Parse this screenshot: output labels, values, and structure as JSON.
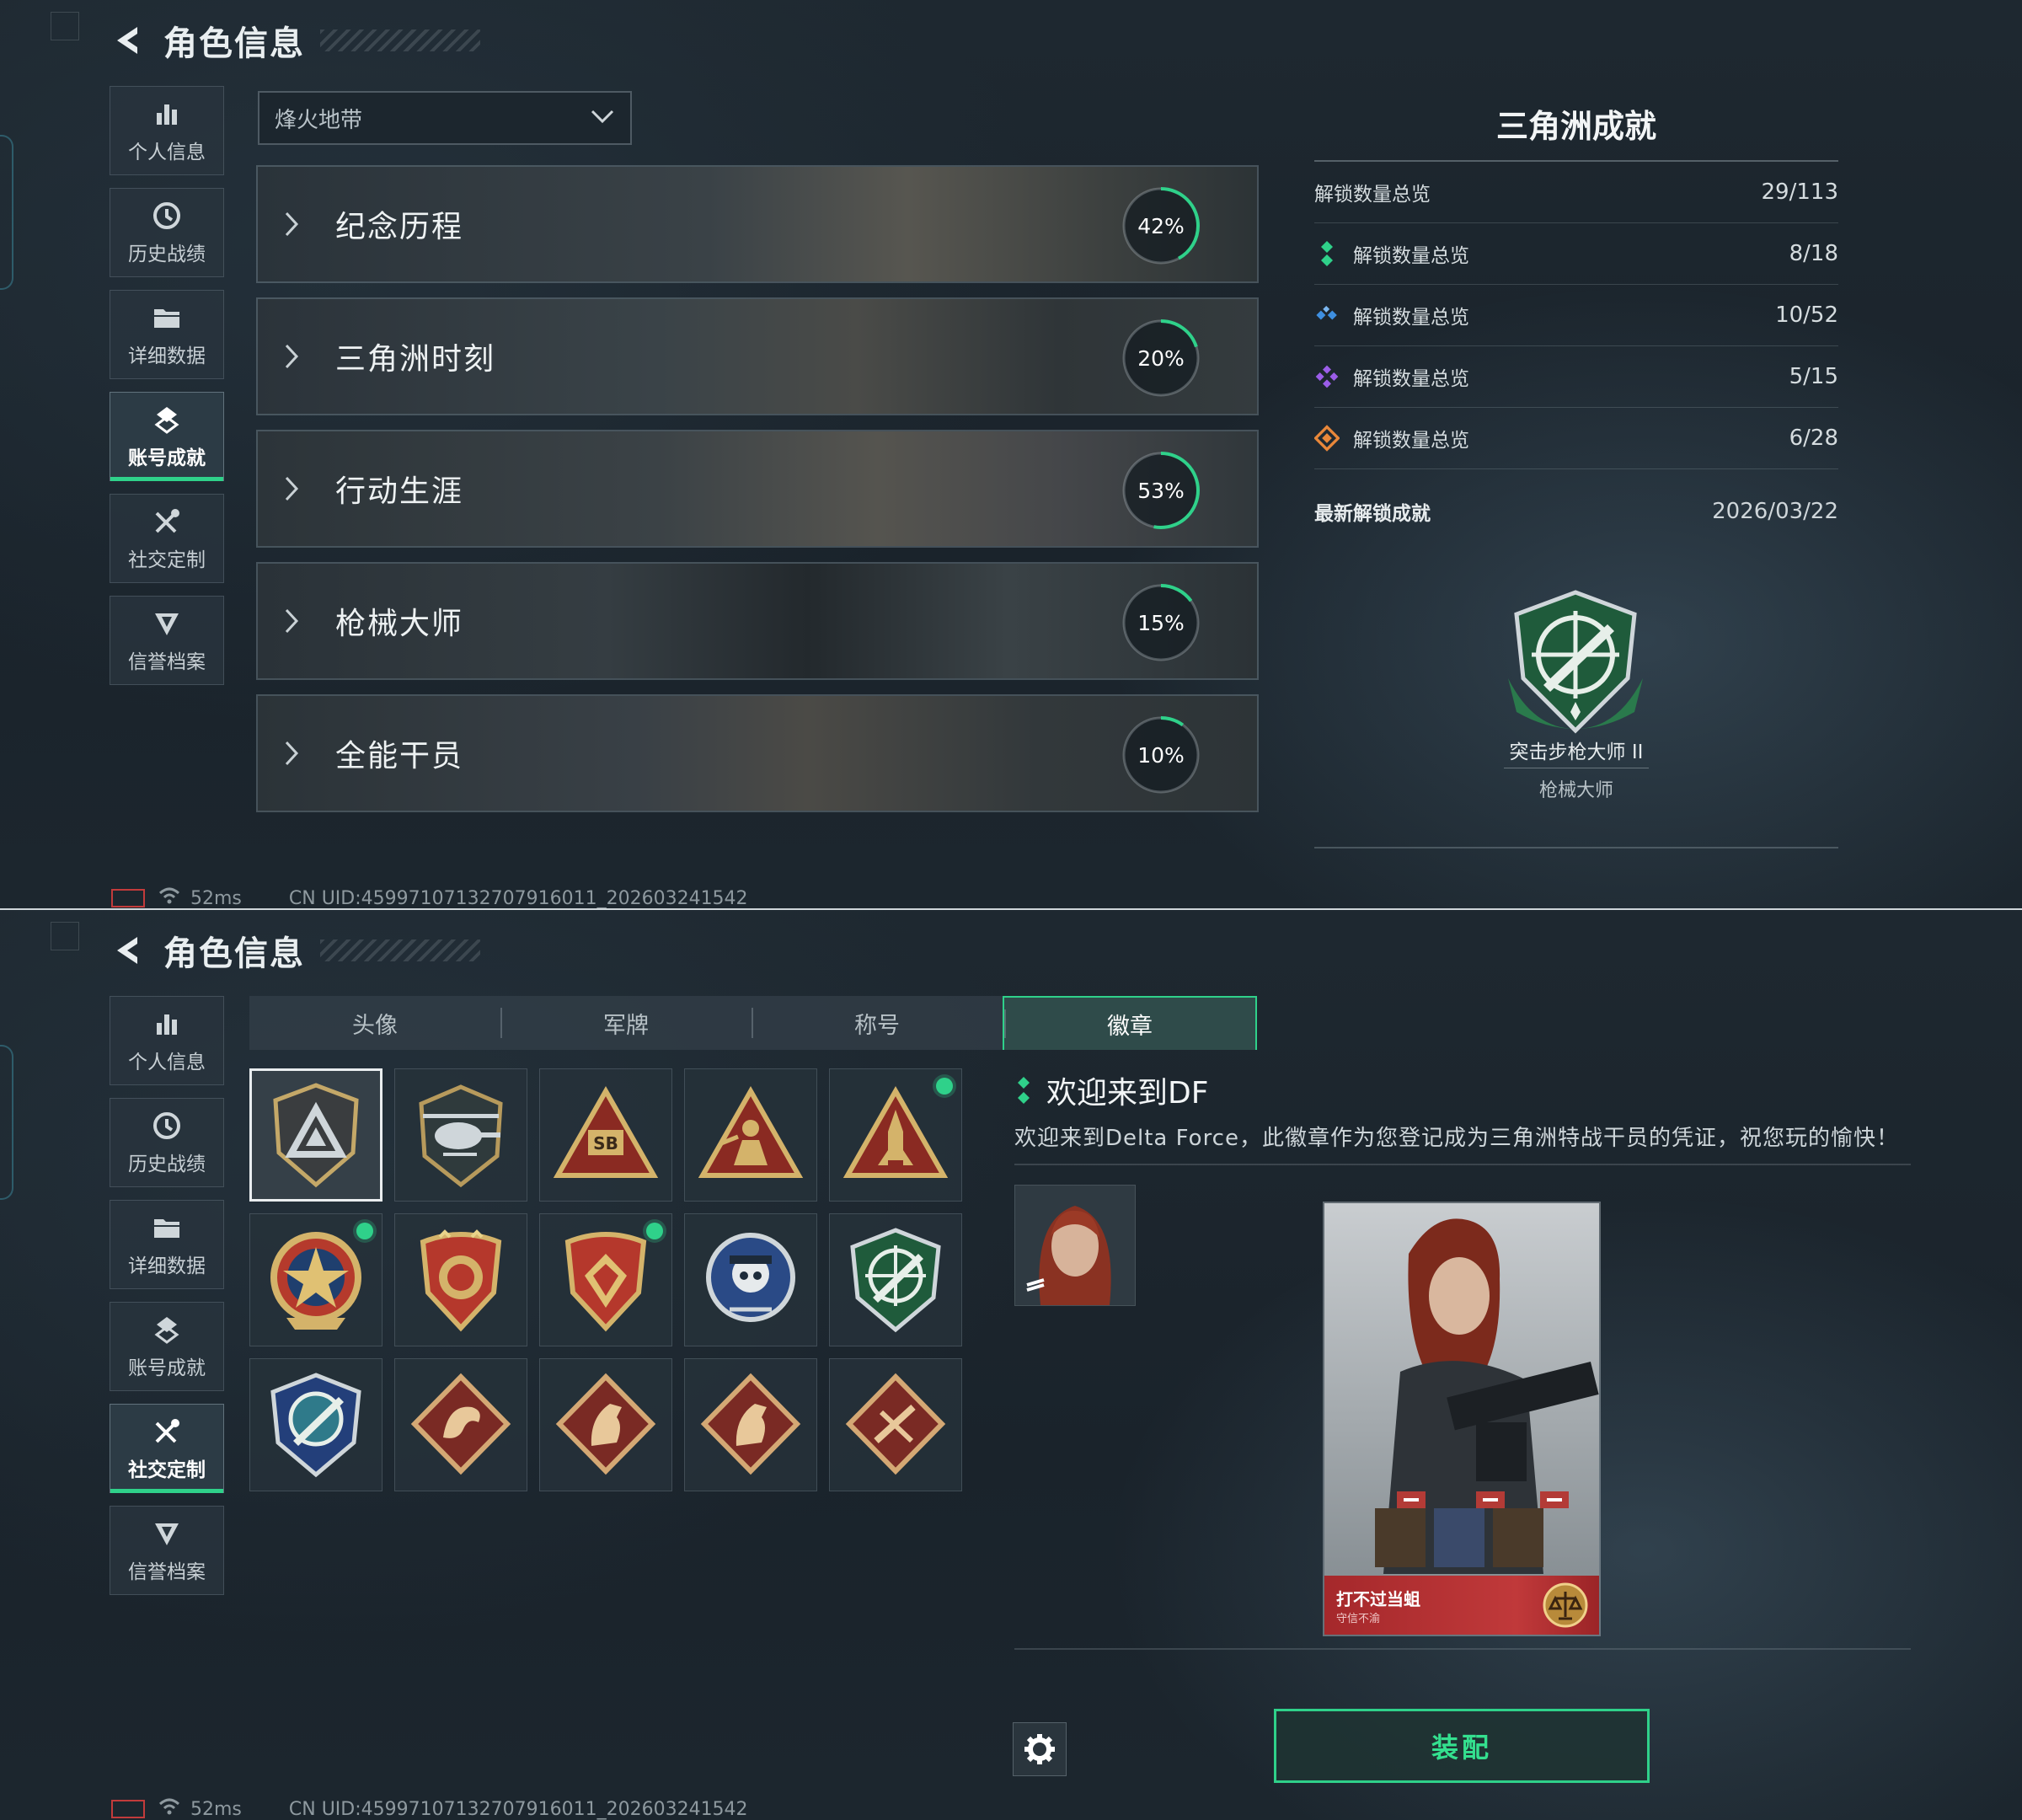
{
  "header": {
    "title": "角色信息"
  },
  "nav": [
    {
      "label": "个人信息"
    },
    {
      "label": "历史战绩"
    },
    {
      "label": "详细数据"
    },
    {
      "label": "账号成就"
    },
    {
      "label": "社交定制"
    },
    {
      "label": "信誉档案"
    }
  ],
  "top": {
    "mode_select": "烽火地带",
    "categories": [
      {
        "label": "纪念历程",
        "percent": "42%",
        "progress": 0.42
      },
      {
        "label": "三角洲时刻",
        "percent": "20%",
        "progress": 0.2
      },
      {
        "label": "行动生涯",
        "percent": "53%",
        "progress": 0.53
      },
      {
        "label": "枪械大师",
        "percent": "15%",
        "progress": 0.15
      },
      {
        "label": "全能干员",
        "percent": "10%",
        "progress": 0.1
      }
    ],
    "stats": {
      "title": "三角洲成就",
      "rows": [
        {
          "label": "解锁数量总览",
          "value": "29/113",
          "icon": "none"
        },
        {
          "label": "解锁数量总览",
          "value": "8/18",
          "icon": "green-diamond-icon",
          "color": "#2fd18a"
        },
        {
          "label": "解锁数量总览",
          "value": "10/52",
          "icon": "blue-diamond-icon",
          "color": "#3e8fe0"
        },
        {
          "label": "解锁数量总览",
          "value": "5/15",
          "icon": "purple-diamond-icon",
          "color": "#9b5de8"
        },
        {
          "label": "解锁数量总览",
          "value": "6/28",
          "icon": "orange-diamond-icon",
          "color": "#e8873a"
        }
      ],
      "latest_label": "最新解锁成就",
      "latest_date": "2026/03/22",
      "latest_badge_name": "突击步枪大师 II",
      "latest_badge_category": "枪械大师"
    }
  },
  "status": {
    "ping": "52ms",
    "uid": "CN UID:45997107132707916011_202603241542"
  },
  "bottom": {
    "tabs": [
      {
        "label": "头像"
      },
      {
        "label": "军牌"
      },
      {
        "label": "称号"
      },
      {
        "label": "徽章"
      }
    ],
    "active_tab": "徽章",
    "detail": {
      "title": "欢迎来到DF",
      "desc": "欢迎来到Delta Force，此徽章作为您登记成为三角洲特战干员的凭证，祝您玩的愉快！",
      "card_name": "打不过当蛆",
      "card_sub": "守信不渝"
    },
    "equip_label": "装配"
  },
  "colors": {
    "accent": "#2fd18a",
    "background": "#1b242c",
    "card_red": "#c0393a"
  }
}
